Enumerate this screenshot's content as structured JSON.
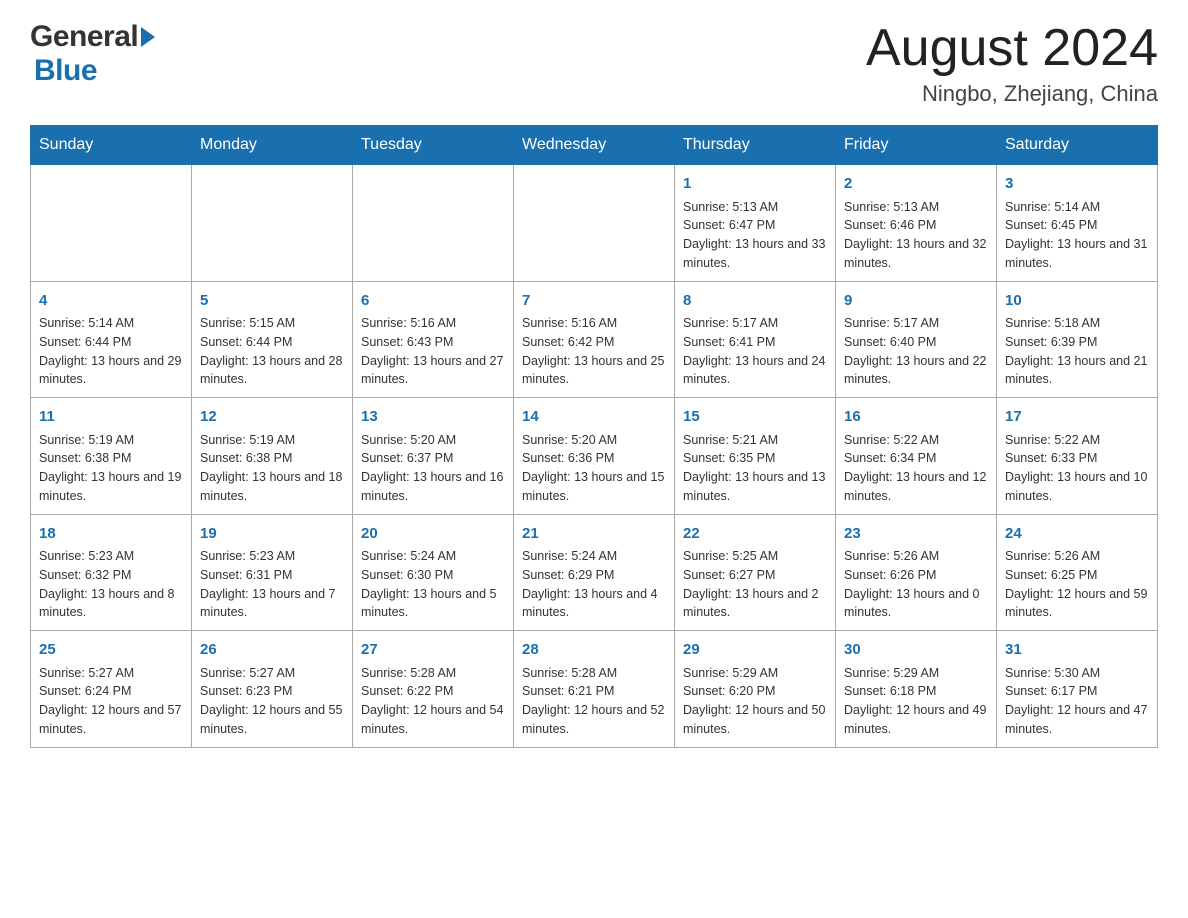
{
  "header": {
    "logo_general": "General",
    "logo_arrow": "",
    "logo_blue": "Blue",
    "month_year": "August 2024",
    "location": "Ningbo, Zhejiang, China"
  },
  "calendar": {
    "days_of_week": [
      "Sunday",
      "Monday",
      "Tuesday",
      "Wednesday",
      "Thursday",
      "Friday",
      "Saturday"
    ],
    "weeks": [
      [
        {
          "day": "",
          "info": ""
        },
        {
          "day": "",
          "info": ""
        },
        {
          "day": "",
          "info": ""
        },
        {
          "day": "",
          "info": ""
        },
        {
          "day": "1",
          "info": "Sunrise: 5:13 AM\nSunset: 6:47 PM\nDaylight: 13 hours and 33 minutes."
        },
        {
          "day": "2",
          "info": "Sunrise: 5:13 AM\nSunset: 6:46 PM\nDaylight: 13 hours and 32 minutes."
        },
        {
          "day": "3",
          "info": "Sunrise: 5:14 AM\nSunset: 6:45 PM\nDaylight: 13 hours and 31 minutes."
        }
      ],
      [
        {
          "day": "4",
          "info": "Sunrise: 5:14 AM\nSunset: 6:44 PM\nDaylight: 13 hours and 29 minutes."
        },
        {
          "day": "5",
          "info": "Sunrise: 5:15 AM\nSunset: 6:44 PM\nDaylight: 13 hours and 28 minutes."
        },
        {
          "day": "6",
          "info": "Sunrise: 5:16 AM\nSunset: 6:43 PM\nDaylight: 13 hours and 27 minutes."
        },
        {
          "day": "7",
          "info": "Sunrise: 5:16 AM\nSunset: 6:42 PM\nDaylight: 13 hours and 25 minutes."
        },
        {
          "day": "8",
          "info": "Sunrise: 5:17 AM\nSunset: 6:41 PM\nDaylight: 13 hours and 24 minutes."
        },
        {
          "day": "9",
          "info": "Sunrise: 5:17 AM\nSunset: 6:40 PM\nDaylight: 13 hours and 22 minutes."
        },
        {
          "day": "10",
          "info": "Sunrise: 5:18 AM\nSunset: 6:39 PM\nDaylight: 13 hours and 21 minutes."
        }
      ],
      [
        {
          "day": "11",
          "info": "Sunrise: 5:19 AM\nSunset: 6:38 PM\nDaylight: 13 hours and 19 minutes."
        },
        {
          "day": "12",
          "info": "Sunrise: 5:19 AM\nSunset: 6:38 PM\nDaylight: 13 hours and 18 minutes."
        },
        {
          "day": "13",
          "info": "Sunrise: 5:20 AM\nSunset: 6:37 PM\nDaylight: 13 hours and 16 minutes."
        },
        {
          "day": "14",
          "info": "Sunrise: 5:20 AM\nSunset: 6:36 PM\nDaylight: 13 hours and 15 minutes."
        },
        {
          "day": "15",
          "info": "Sunrise: 5:21 AM\nSunset: 6:35 PM\nDaylight: 13 hours and 13 minutes."
        },
        {
          "day": "16",
          "info": "Sunrise: 5:22 AM\nSunset: 6:34 PM\nDaylight: 13 hours and 12 minutes."
        },
        {
          "day": "17",
          "info": "Sunrise: 5:22 AM\nSunset: 6:33 PM\nDaylight: 13 hours and 10 minutes."
        }
      ],
      [
        {
          "day": "18",
          "info": "Sunrise: 5:23 AM\nSunset: 6:32 PM\nDaylight: 13 hours and 8 minutes."
        },
        {
          "day": "19",
          "info": "Sunrise: 5:23 AM\nSunset: 6:31 PM\nDaylight: 13 hours and 7 minutes."
        },
        {
          "day": "20",
          "info": "Sunrise: 5:24 AM\nSunset: 6:30 PM\nDaylight: 13 hours and 5 minutes."
        },
        {
          "day": "21",
          "info": "Sunrise: 5:24 AM\nSunset: 6:29 PM\nDaylight: 13 hours and 4 minutes."
        },
        {
          "day": "22",
          "info": "Sunrise: 5:25 AM\nSunset: 6:27 PM\nDaylight: 13 hours and 2 minutes."
        },
        {
          "day": "23",
          "info": "Sunrise: 5:26 AM\nSunset: 6:26 PM\nDaylight: 13 hours and 0 minutes."
        },
        {
          "day": "24",
          "info": "Sunrise: 5:26 AM\nSunset: 6:25 PM\nDaylight: 12 hours and 59 minutes."
        }
      ],
      [
        {
          "day": "25",
          "info": "Sunrise: 5:27 AM\nSunset: 6:24 PM\nDaylight: 12 hours and 57 minutes."
        },
        {
          "day": "26",
          "info": "Sunrise: 5:27 AM\nSunset: 6:23 PM\nDaylight: 12 hours and 55 minutes."
        },
        {
          "day": "27",
          "info": "Sunrise: 5:28 AM\nSunset: 6:22 PM\nDaylight: 12 hours and 54 minutes."
        },
        {
          "day": "28",
          "info": "Sunrise: 5:28 AM\nSunset: 6:21 PM\nDaylight: 12 hours and 52 minutes."
        },
        {
          "day": "29",
          "info": "Sunrise: 5:29 AM\nSunset: 6:20 PM\nDaylight: 12 hours and 50 minutes."
        },
        {
          "day": "30",
          "info": "Sunrise: 5:29 AM\nSunset: 6:18 PM\nDaylight: 12 hours and 49 minutes."
        },
        {
          "day": "31",
          "info": "Sunrise: 5:30 AM\nSunset: 6:17 PM\nDaylight: 12 hours and 47 minutes."
        }
      ]
    ]
  }
}
